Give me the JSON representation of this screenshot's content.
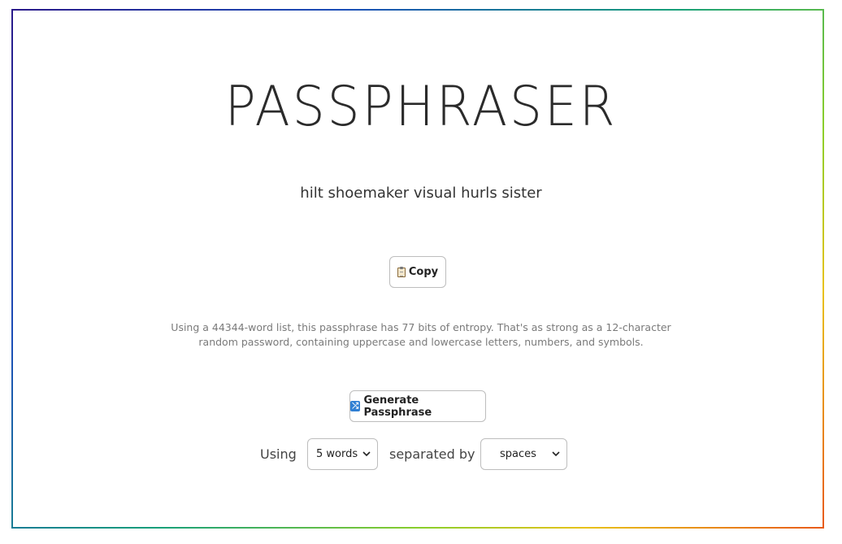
{
  "app": {
    "title": "PASSPHRASER"
  },
  "passphrase": {
    "text": "hilt shoemaker visual hurls sister"
  },
  "copy_button": {
    "label": "Copy",
    "icon": "clipboard-icon"
  },
  "info": {
    "text": "Using a 44344-word list, this passphrase has 77 bits of entropy. That's as strong as a 12-character random password, containing uppercase and lowercase letters, numbers, and symbols."
  },
  "generate_button": {
    "label": "Generate Passphrase",
    "icon": "shuffle-icon"
  },
  "controls": {
    "using_label": "Using",
    "words_select_value": "5 words",
    "separated_label": "separated by",
    "separator_select_value": "spaces"
  },
  "colors": {
    "border_gradient": [
      "#2a1a8a",
      "#1c4fb8",
      "#18a07a",
      "#8ccf2a",
      "#e8c21a",
      "#e85a1a"
    ],
    "shuffle_icon_bg": "#2f7fd3"
  }
}
